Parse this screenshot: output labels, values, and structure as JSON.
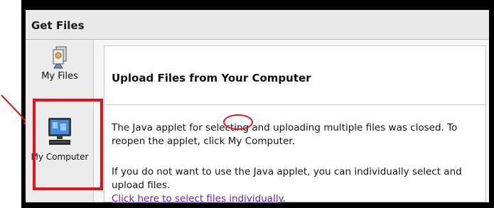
{
  "window": {
    "title": "Get Files"
  },
  "sidebar": {
    "items": [
      {
        "label": "My Files",
        "icon": "my-files-icon"
      },
      {
        "label": "My Computer",
        "icon": "my-computer-icon"
      }
    ]
  },
  "content": {
    "heading": "Upload Files from Your Computer",
    "paragraph1": "The Java applet for selecting and uploading multiple files was closed. To reopen the applet, click My Computer.",
    "paragraph2_text": "If you do not want to use the Java applet, you can individually select and upload files.",
    "paragraph2_link": "Click here to select files individually",
    "paragraph2_end": "."
  },
  "colors": {
    "annotation": "#e0141c",
    "link": "#6b21a8",
    "frame": "#000000"
  }
}
